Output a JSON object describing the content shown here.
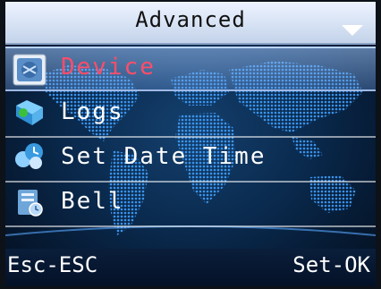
{
  "header": {
    "title": "Advanced"
  },
  "menu": {
    "items": [
      {
        "label": "Device",
        "icon": "device-icon",
        "selected": true
      },
      {
        "label": "Logs",
        "icon": "logs-icon",
        "selected": false
      },
      {
        "label": "Set Date Time",
        "icon": "set-date-time-icon",
        "selected": false
      },
      {
        "label": "Bell",
        "icon": "bell-icon",
        "selected": false
      }
    ]
  },
  "softkeys": {
    "left": "Esc-ESC",
    "right": "Set-OK"
  },
  "colors": {
    "selected_text": "#ff4d6a",
    "normal_text": "#ffffff",
    "title_bar": "#dfe8f7",
    "background": "#0a2a4e"
  }
}
